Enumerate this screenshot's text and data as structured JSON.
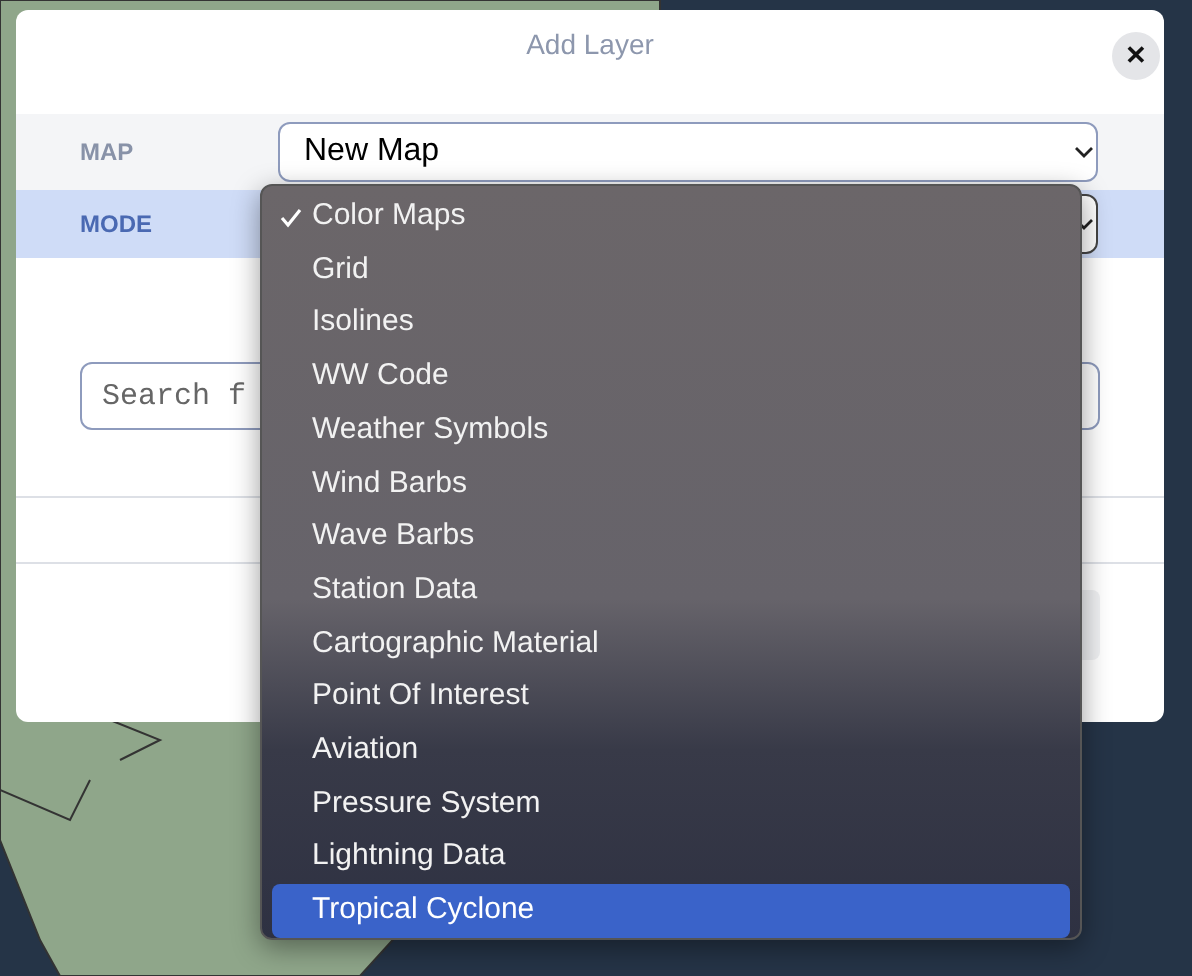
{
  "dialog": {
    "title": "Add Layer",
    "close": "✕"
  },
  "fields": [
    {
      "label": "MAP",
      "value": "New Map",
      "selected": false
    },
    {
      "label": "MODE",
      "selected": true
    }
  ],
  "search": {
    "placeholder": "Search f"
  },
  "mode_menu": [
    {
      "label": "Color Maps",
      "checked": true,
      "highlighted": false
    },
    {
      "label": "Grid",
      "checked": false,
      "highlighted": false
    },
    {
      "label": "Isolines",
      "checked": false,
      "highlighted": false
    },
    {
      "label": "WW Code",
      "checked": false,
      "highlighted": false
    },
    {
      "label": "Weather Symbols",
      "checked": false,
      "highlighted": false
    },
    {
      "label": "Wind Barbs",
      "checked": false,
      "highlighted": false
    },
    {
      "label": "Wave Barbs",
      "checked": false,
      "highlighted": false
    },
    {
      "label": "Station Data",
      "checked": false,
      "highlighted": false
    },
    {
      "label": "Cartographic Material",
      "checked": false,
      "highlighted": false
    },
    {
      "label": "Point Of Interest",
      "checked": false,
      "highlighted": false
    },
    {
      "label": "Aviation",
      "checked": false,
      "highlighted": false
    },
    {
      "label": "Pressure System",
      "checked": false,
      "highlighted": false
    },
    {
      "label": "Lightning Data",
      "checked": false,
      "highlighted": false
    },
    {
      "label": "Tropical Cyclone",
      "checked": false,
      "highlighted": true
    }
  ]
}
